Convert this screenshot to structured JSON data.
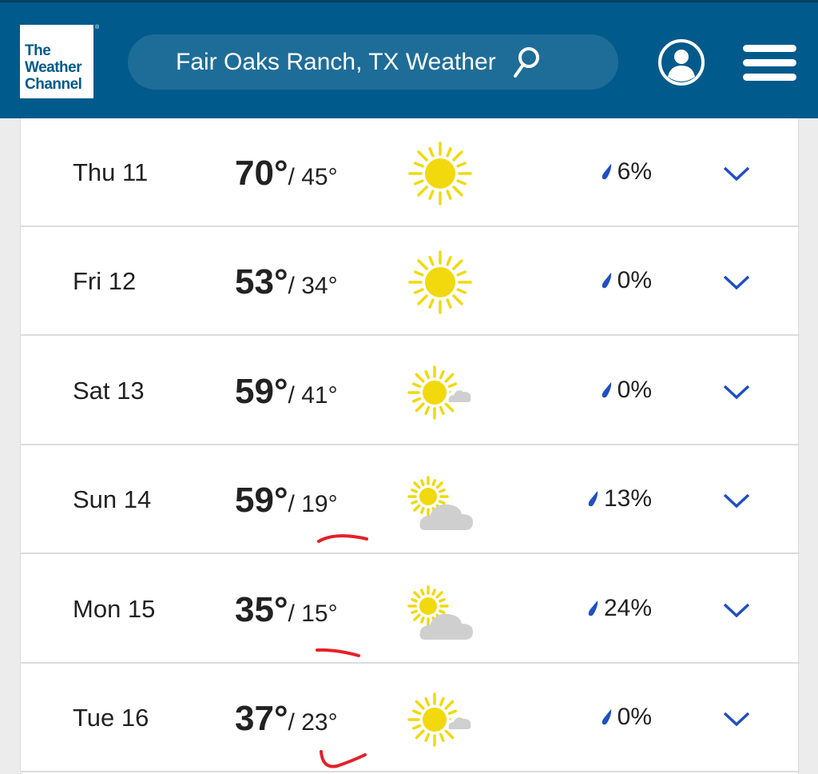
{
  "header": {
    "logo_text": [
      "The",
      "Weather",
      "Channel"
    ],
    "search_text": "Fair Oaks Ranch, TX Weather"
  },
  "colors": {
    "brand": "#005a8c",
    "rain": "#1f4fc2",
    "chevron": "#1f4fc2",
    "sun": "#f1d90e",
    "cloud": "#cfcfcf",
    "annotation": "#e5202a"
  },
  "days": [
    {
      "day": "Thu 11",
      "high": "70°",
      "low": "/ 45°",
      "icon": "sunny",
      "precip": "6%"
    },
    {
      "day": "Fri 12",
      "high": "53°",
      "low": "/ 34°",
      "icon": "sunny",
      "precip": "0%"
    },
    {
      "day": "Sat 13",
      "high": "59°",
      "low": "/ 41°",
      "icon": "mostly-sunny",
      "precip": "0%"
    },
    {
      "day": "Sun 14",
      "high": "59°",
      "low": "/ 19°",
      "icon": "partly-cloudy",
      "precip": "13%"
    },
    {
      "day": "Mon 15",
      "high": "35°",
      "low": "/ 15°",
      "icon": "partly-cloudy",
      "precip": "24%"
    },
    {
      "day": "Tue 16",
      "high": "37°",
      "low": "/ 23°",
      "icon": "mostly-sunny",
      "precip": "0%"
    }
  ]
}
